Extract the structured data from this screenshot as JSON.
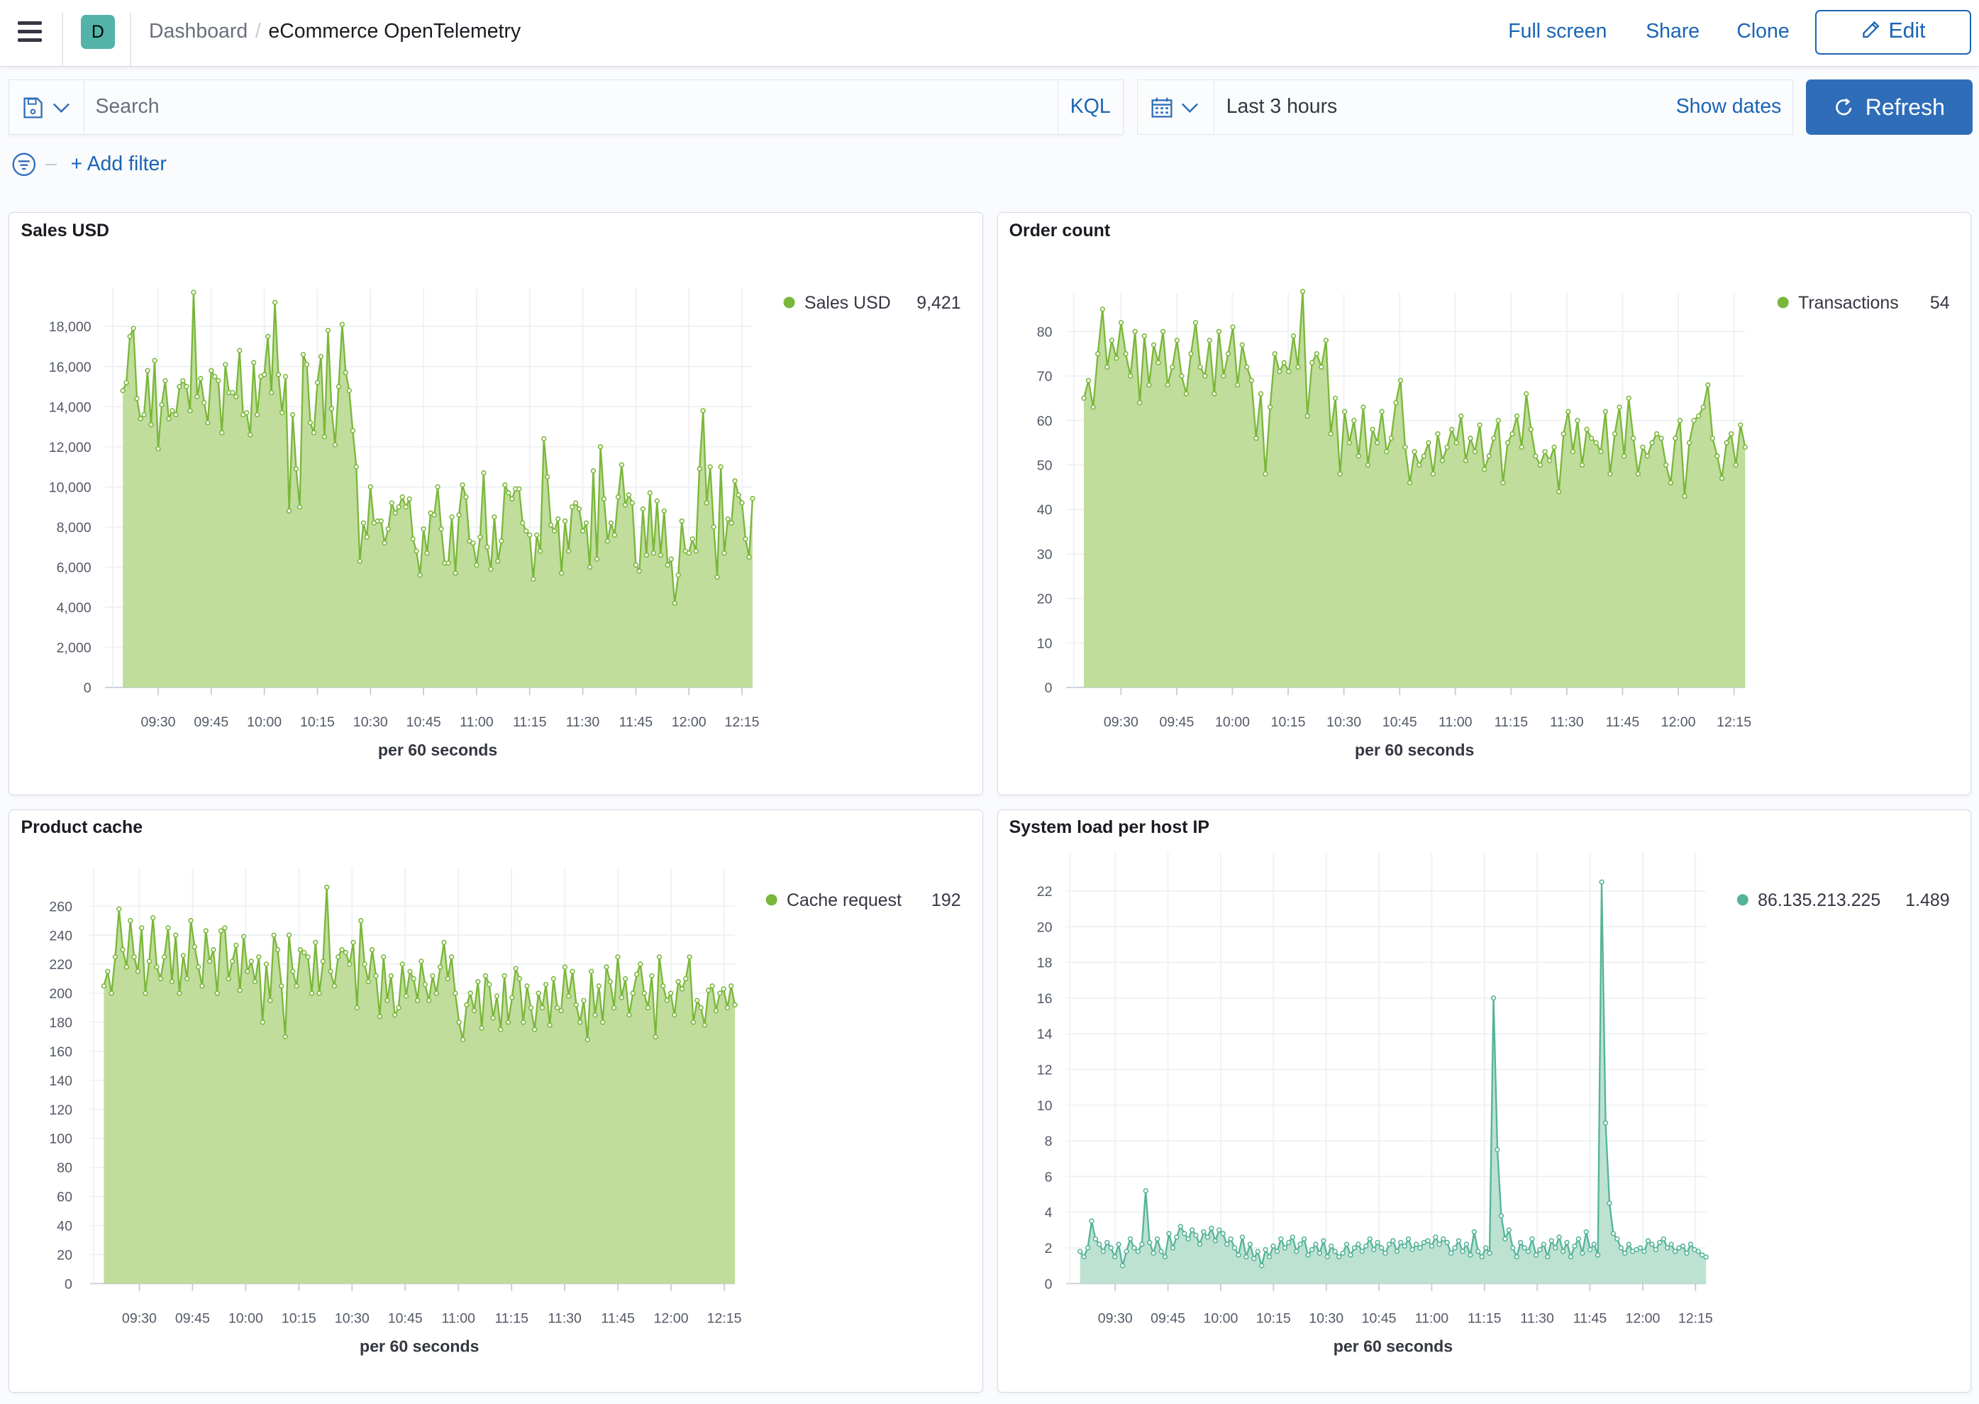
{
  "header": {
    "avatar_letter": "D",
    "breadcrumbs": [
      "Dashboard",
      "eCommerce OpenTelemetry"
    ],
    "actions": [
      "Full screen",
      "Share",
      "Clone"
    ],
    "edit_label": "Edit"
  },
  "query": {
    "search_placeholder": "Search",
    "language": "KQL",
    "time_range": "Last 3 hours",
    "show_dates": "Show dates",
    "refresh_label": "Refresh",
    "add_filter": "+ Add filter"
  },
  "colors": {
    "accent": "#2f6db9",
    "link": "#1b64b5",
    "green_line": "#7ab73a",
    "green_fill": "#bddb97",
    "teal_line": "#54b399",
    "teal_fill": "#b9e0cf"
  },
  "chart_data": [
    {
      "type": "area",
      "title": "Sales USD",
      "xlabel": "per 60 seconds",
      "x_range": [
        "09:20",
        "12:18"
      ],
      "x_ticks": [
        "09:30",
        "09:45",
        "10:00",
        "10:15",
        "10:30",
        "10:45",
        "11:00",
        "11:15",
        "11:30",
        "11:45",
        "12:00",
        "12:15"
      ],
      "y_ticks": [
        0,
        2000,
        4000,
        6000,
        8000,
        10000,
        12000,
        14000,
        16000,
        18000
      ],
      "y_tick_labels": [
        "0",
        "2,000",
        "4,000",
        "6,000",
        "8,000",
        "10,000",
        "12,000",
        "14,000",
        "16,000",
        "18,000"
      ],
      "ylim": [
        0,
        18000
      ],
      "grid": true,
      "legend_position": "right",
      "color": "green",
      "series": [
        {
          "name": "Sales USD",
          "last_value": "9,421",
          "values": [
            14800,
            15200,
            17500,
            17900,
            14400,
            13400,
            13600,
            15800,
            13100,
            16300,
            11900,
            14100,
            15300,
            13400,
            13800,
            13600,
            15000,
            15300,
            15000,
            13800,
            19700,
            14500,
            15400,
            14200,
            13200,
            15800,
            15500,
            15300,
            12700,
            16100,
            14700,
            14700,
            14500,
            16800,
            13600,
            13700,
            12600,
            16200,
            13600,
            15500,
            15600,
            17500,
            14700,
            19200,
            15600,
            13700,
            15500,
            8800,
            13600,
            10900,
            9000,
            16600,
            16100,
            13200,
            12700,
            15200,
            16500,
            12500,
            17800,
            13900,
            12100,
            15000,
            18100,
            15700,
            14800,
            12800,
            11000,
            6300,
            8200,
            7500,
            10000,
            8200,
            8300,
            8300,
            7200,
            7900,
            9200,
            8700,
            9000,
            9500,
            9000,
            9400,
            7400,
            6800,
            5600,
            7900,
            6700,
            8700,
            8600,
            10000,
            7900,
            6200,
            6200,
            8500,
            5700,
            8600,
            10100,
            9500,
            7300,
            7200,
            6100,
            7500,
            10700,
            7000,
            5900,
            8500,
            6300,
            7300,
            10100,
            9700,
            9400,
            9900,
            9900,
            8200,
            7800,
            7600,
            5400,
            7600,
            6800,
            12400,
            10500,
            8100,
            7800,
            8400,
            5700,
            8300,
            6800,
            9000,
            9200,
            8900,
            7800,
            8200,
            6000,
            10800,
            6400,
            12000,
            9400,
            7300,
            8200,
            7600,
            9500,
            11100,
            9100,
            9600,
            9200,
            6100,
            5800,
            8900,
            6600,
            9700,
            6700,
            9300,
            6600,
            8800,
            6100,
            6400,
            4200,
            5600,
            8300,
            6800,
            6700,
            7400,
            6800,
            10900,
            13800,
            9200,
            11000,
            8000,
            5500,
            11000,
            6700,
            8400,
            8200,
            10300,
            9600,
            9200,
            7400,
            6500,
            9421
          ]
        }
      ]
    },
    {
      "type": "area",
      "title": "Order count",
      "xlabel": "per 60 seconds",
      "x_range": [
        "09:20",
        "12:18"
      ],
      "x_ticks": [
        "09:30",
        "09:45",
        "10:00",
        "10:15",
        "10:30",
        "10:45",
        "11:00",
        "11:15",
        "11:30",
        "11:45",
        "12:00",
        "12:15"
      ],
      "y_ticks": [
        0,
        10,
        20,
        30,
        40,
        50,
        60,
        70,
        80
      ],
      "y_tick_labels": [
        "0",
        "10",
        "20",
        "30",
        "40",
        "50",
        "60",
        "70",
        "80"
      ],
      "ylim": [
        0,
        80
      ],
      "grid": true,
      "legend_position": "right",
      "color": "green",
      "series": [
        {
          "name": "Transactions",
          "last_value": "54",
          "values": [
            65,
            69,
            63,
            75,
            85,
            72,
            78,
            74,
            82,
            75,
            70,
            80,
            64,
            79,
            68,
            77,
            73,
            80,
            68,
            72,
            78,
            70,
            66,
            75,
            82,
            72,
            70,
            78,
            66,
            80,
            70,
            75,
            81,
            68,
            77,
            72,
            69,
            56,
            66,
            48,
            63,
            75,
            71,
            73,
            71,
            79,
            72,
            89,
            61,
            73,
            75,
            72,
            78,
            57,
            65,
            48,
            62,
            55,
            60,
            52,
            63,
            50,
            58,
            55,
            62,
            53,
            56,
            64,
            69,
            54,
            46,
            53,
            50,
            52,
            55,
            48,
            57,
            51,
            54,
            58,
            55,
            61,
            51,
            56,
            53,
            59,
            49,
            52,
            56,
            60,
            46,
            55,
            57,
            61,
            54,
            66,
            58,
            52,
            50,
            53,
            51,
            54,
            44,
            57,
            62,
            53,
            60,
            50,
            58,
            56,
            55,
            53,
            62,
            48,
            57,
            63,
            52,
            65,
            56,
            48,
            54,
            52,
            55,
            57,
            56,
            50,
            46,
            56,
            60,
            43,
            55,
            60,
            61,
            63,
            68,
            56,
            52,
            47,
            55,
            57,
            50,
            59,
            54
          ]
        }
      ]
    },
    {
      "type": "area",
      "title": "Product cache",
      "xlabel": "per 60 seconds",
      "x_range": [
        "09:20",
        "12:18"
      ],
      "x_ticks": [
        "09:30",
        "09:45",
        "10:00",
        "10:15",
        "10:30",
        "10:45",
        "11:00",
        "11:15",
        "11:30",
        "11:45",
        "12:00",
        "12:15"
      ],
      "y_ticks": [
        0,
        20,
        40,
        60,
        80,
        100,
        120,
        140,
        160,
        180,
        200,
        220,
        240,
        260
      ],
      "y_tick_labels": [
        "0",
        "20",
        "40",
        "60",
        "80",
        "100",
        "120",
        "140",
        "160",
        "180",
        "200",
        "220",
        "240",
        "260"
      ],
      "ylim": [
        0,
        260
      ],
      "grid": true,
      "legend_position": "right",
      "color": "green",
      "series": [
        {
          "name": "Cache request",
          "last_value": "192",
          "values": [
            205,
            215,
            200,
            225,
            258,
            230,
            218,
            250,
            225,
            215,
            245,
            200,
            222,
            252,
            218,
            210,
            225,
            245,
            208,
            240,
            200,
            226,
            210,
            250,
            232,
            218,
            205,
            243,
            222,
            230,
            200,
            243,
            245,
            210,
            222,
            233,
            202,
            239,
            215,
            222,
            208,
            225,
            180,
            220,
            195,
            240,
            230,
            205,
            170,
            240,
            215,
            205,
            230,
            228,
            225,
            200,
            235,
            200,
            222,
            273,
            215,
            205,
            225,
            230,
            228,
            220,
            235,
            190,
            250,
            220,
            208,
            230,
            212,
            184,
            225,
            195,
            212,
            185,
            190,
            220,
            198,
            215,
            210,
            195,
            222,
            206,
            195,
            212,
            200,
            218,
            235,
            210,
            225,
            200,
            180,
            168,
            192,
            200,
            188,
            208,
            176,
            212,
            206,
            183,
            198,
            175,
            212,
            180,
            197,
            217,
            210,
            180,
            205,
            190,
            175,
            200,
            190,
            206,
            178,
            210,
            190,
            188,
            218,
            198,
            215,
            192,
            180,
            195,
            168,
            215,
            185,
            205,
            180,
            218,
            208,
            190,
            225,
            197,
            210,
            185,
            200,
            213,
            220,
            200,
            190,
            212,
            170,
            225,
            205,
            195,
            200,
            185,
            208,
            203,
            210,
            225,
            180,
            195,
            190,
            178,
            202,
            205,
            188,
            200,
            203,
            190,
            205,
            192
          ]
        }
      ]
    },
    {
      "type": "area",
      "title": "System load per host IP",
      "xlabel": "per 60 seconds",
      "x_range": [
        "09:20",
        "12:18"
      ],
      "x_ticks": [
        "09:30",
        "09:45",
        "10:00",
        "10:15",
        "10:30",
        "10:45",
        "11:00",
        "11:15",
        "11:30",
        "11:45",
        "12:00",
        "12:15"
      ],
      "y_ticks": [
        0,
        2,
        4,
        6,
        8,
        10,
        12,
        14,
        16,
        18,
        20,
        22
      ],
      "y_tick_labels": [
        "0",
        "2",
        "4",
        "6",
        "8",
        "10",
        "12",
        "14",
        "16",
        "18",
        "20",
        "22"
      ],
      "ylim": [
        0,
        22
      ],
      "grid": true,
      "legend_position": "right",
      "color": "teal",
      "series": [
        {
          "name": "86.135.213.225",
          "last_value": "1.489",
          "values": [
            1.8,
            1.5,
            2.0,
            3.5,
            2.5,
            2.2,
            1.8,
            2.3,
            2.0,
            1.5,
            2.2,
            1.0,
            1.8,
            2.5,
            2.0,
            1.8,
            2.2,
            5.2,
            2.3,
            1.7,
            2.5,
            1.8,
            1.5,
            2.8,
            2.0,
            2.6,
            3.2,
            2.8,
            2.5,
            3.0,
            2.7,
            2.2,
            2.9,
            2.6,
            3.1,
            2.4,
            3.0,
            2.8,
            2.2,
            2.5,
            2.0,
            1.6,
            2.6,
            1.5,
            2.2,
            1.4,
            1.8,
            1.0,
            1.9,
            1.5,
            2.1,
            1.8,
            2.5,
            2.0,
            2.3,
            2.6,
            1.8,
            2.2,
            2.5,
            1.6,
            1.9,
            2.2,
            1.7,
            2.4,
            1.5,
            2.1,
            1.8,
            1.5,
            1.7,
            2.2,
            1.6,
            2.0,
            2.2,
            1.8,
            2.1,
            2.5,
            1.9,
            2.3,
            2.0,
            1.7,
            2.2,
            2.4,
            1.8,
            2.3,
            2.1,
            2.5,
            1.9,
            2.2,
            2.0,
            2.3,
            2.4,
            2.1,
            2.6,
            2.2,
            2.5,
            2.3,
            1.7,
            2.0,
            2.4,
            1.8,
            2.2,
            1.6,
            2.9,
            1.8,
            1.5,
            2.0,
            1.7,
            16.0,
            7.5,
            3.8,
            2.5,
            3.0,
            2.0,
            1.5,
            2.3,
            2.0,
            1.8,
            2.5,
            1.6,
            1.9,
            2.2,
            1.5,
            2.4,
            2.0,
            2.6,
            1.8,
            2.3,
            1.5,
            2.1,
            2.5,
            1.7,
            2.9,
            1.9,
            2.2,
            1.6,
            22.5,
            9.0,
            4.5,
            2.8,
            2.5,
            2.0,
            1.7,
            2.2,
            1.8,
            1.9,
            2.0,
            1.8,
            2.4,
            2.2,
            1.9,
            2.3,
            2.5,
            2.0,
            2.2,
            1.8,
            2.0,
            2.1,
            1.7,
            2.2,
            1.9,
            1.8,
            1.6,
            1.489
          ]
        }
      ]
    }
  ]
}
